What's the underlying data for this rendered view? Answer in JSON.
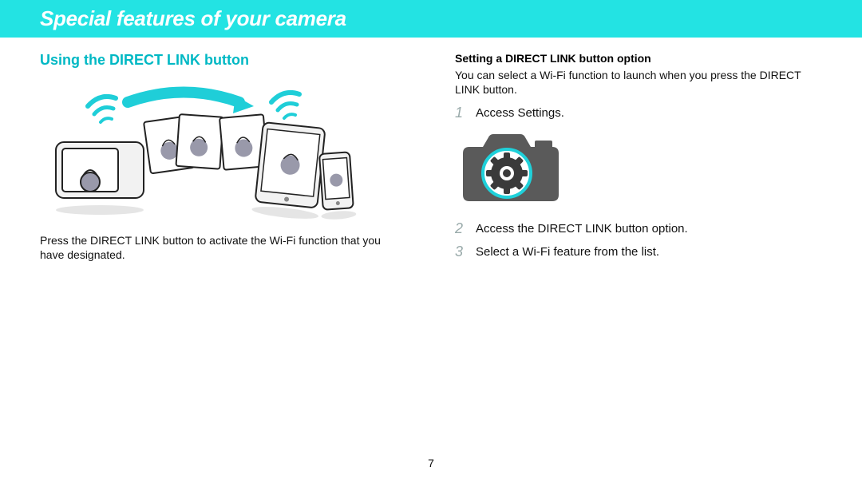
{
  "header": {
    "title": "Special features of your camera"
  },
  "left": {
    "subtitle": "Using the DIRECT LINK button",
    "body": "Press the DIRECT LINK button to activate the Wi-Fi function that you have designated."
  },
  "right": {
    "subtitle": "Setting a DIRECT LINK button option",
    "body": "You can select a Wi-Fi function to launch when you press the DIRECT LINK button.",
    "steps": [
      {
        "num": "1",
        "text": "Access Settings."
      },
      {
        "num": "2",
        "text": "Access the DIRECT LINK button option."
      },
      {
        "num": "3",
        "text": "Select a Wi-Fi feature from the list."
      }
    ]
  },
  "page_number": "7"
}
